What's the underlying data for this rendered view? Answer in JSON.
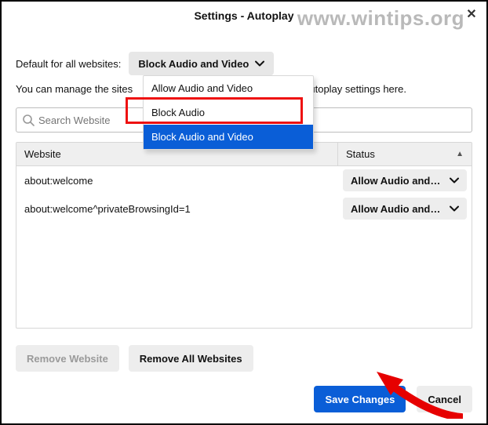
{
  "watermark": "www.wintips.org",
  "window": {
    "title": "Settings - Autoplay",
    "close_glyph": "✕"
  },
  "labels": {
    "default_for_all": "Default for all websites:",
    "description_full": "You can manage the sites that do not follow your default autoplay settings here.",
    "description_left": "You can manage the sites",
    "description_right": "autoplay settings here."
  },
  "default_dropdown": {
    "value": "Block Audio and Video",
    "options": [
      "Allow Audio and Video",
      "Block Audio",
      "Block Audio and Video"
    ],
    "selected_index": 2
  },
  "search": {
    "placeholder": "Search Website"
  },
  "table": {
    "headers": {
      "website": "Website",
      "status": "Status"
    },
    "sort_glyph": "▲",
    "rows": [
      {
        "website": "about:welcome",
        "status": "Allow Audio and…"
      },
      {
        "website": "about:welcome^privateBrowsingId=1",
        "status": "Allow Audio and…"
      }
    ]
  },
  "buttons": {
    "remove_website": "Remove Website",
    "remove_all": "Remove All Websites",
    "save": "Save Changes",
    "cancel": "Cancel"
  },
  "colors": {
    "accent": "#0a5ed7",
    "highlight_border": "#e11",
    "arrow": "#e60000"
  }
}
